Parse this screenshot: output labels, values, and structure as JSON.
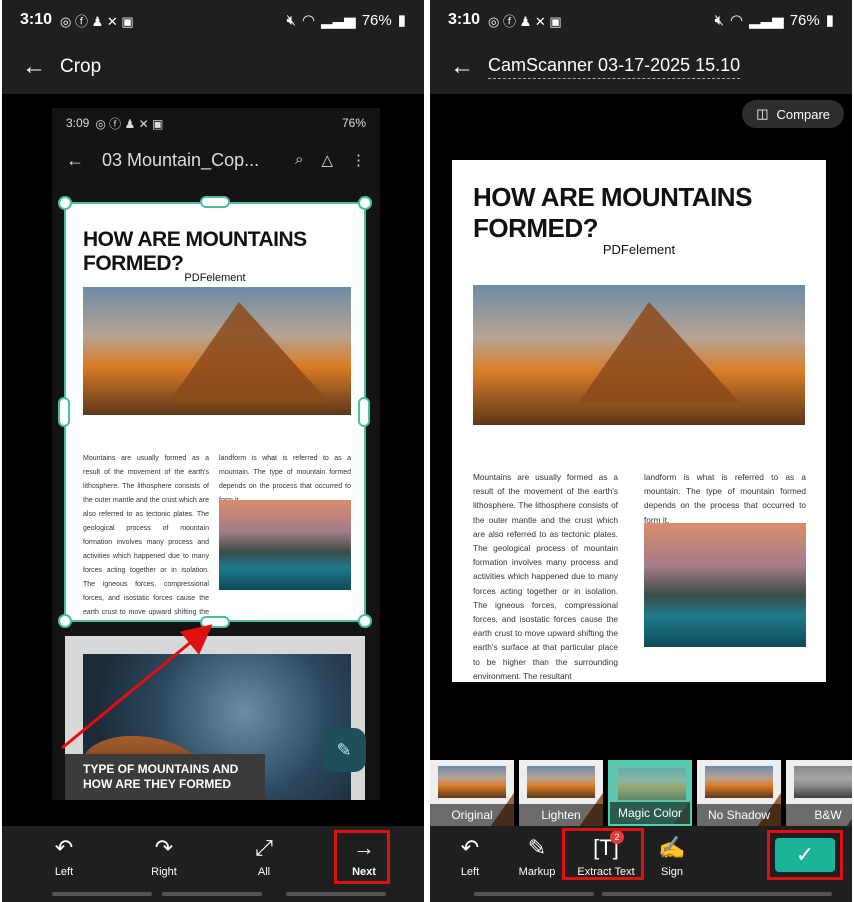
{
  "left": {
    "status": {
      "time": "3:10",
      "battery": "76%"
    },
    "appbar": {
      "title": "Crop"
    },
    "screenshot": {
      "status_time": "3:09",
      "status_battery": "76%",
      "file_title": "03 Mountain_Cop..."
    },
    "document": {
      "heading": "HOW ARE MOUNTAINS FORMED?",
      "subtitle": "PDFelement",
      "col1": "Mountains are usually formed as a result of the movement of the earth's lithosphere. The lithosphere consists of the outer mantle and the crust which are also referred to as tectonic plates. The geological process of mountain formation involves many process and activities which happened due to many forces acting together or in isolation. The igneous forces, compressional forces, and isostatic forces cause the earth crust to move upward shifting the earth's surface at that particular place to be higher than the surrounding environment. The resultant",
      "col2": "landform is what is referred to as a mountain. The type of mountain formed depends on the process that occurred to form it."
    },
    "page2_caption": "TYPE OF MOUNTAINS AND HOW ARE THEY FORMED",
    "toolbar": [
      {
        "label": "Left",
        "icon": "rotate-left-icon"
      },
      {
        "label": "Right",
        "icon": "rotate-right-icon"
      },
      {
        "label": "All",
        "icon": "expand-all-icon"
      },
      {
        "label": "Next",
        "icon": "arrow-right-icon"
      }
    ]
  },
  "right": {
    "status": {
      "time": "3:10",
      "battery": "76%"
    },
    "appbar": {
      "title": "CamScanner 03-17-2025 15.10"
    },
    "compare_label": "Compare",
    "document": {
      "heading": "HOW ARE MOUNTAINS FORMED?",
      "subtitle": "PDFelement",
      "col1": "Mountains are usually formed as a result of the movement of the earth's lithosphere. The lithosphere consists of the outer mantle and the crust which are also referred to as tectonic plates. The geological process of mountain formation involves many process and activities which happened due to many forces acting together or in isolation. The igneous forces, compressional forces, and isostatic forces cause the earth crust to move upward shifting the earth's surface at that particular place to be higher than the surrounding environment. The resultant",
      "col2": "landform is what is referred to as a mountain. The type of mountain formed depends on the process that occurred to form it."
    },
    "filters": [
      "Original",
      "Lighten",
      "Magic Color",
      "No Shadow",
      "B&W"
    ],
    "toolbar": [
      {
        "label": "Left",
        "icon": "rotate-left-icon"
      },
      {
        "label": "Markup",
        "icon": "pen-icon"
      },
      {
        "label": "Extract Text",
        "icon": "text-scan-icon",
        "badge": "2"
      },
      {
        "label": "Sign",
        "icon": "signature-icon"
      }
    ],
    "colors": {
      "accent": "#1bb49a",
      "highlight": "#e01010"
    }
  }
}
